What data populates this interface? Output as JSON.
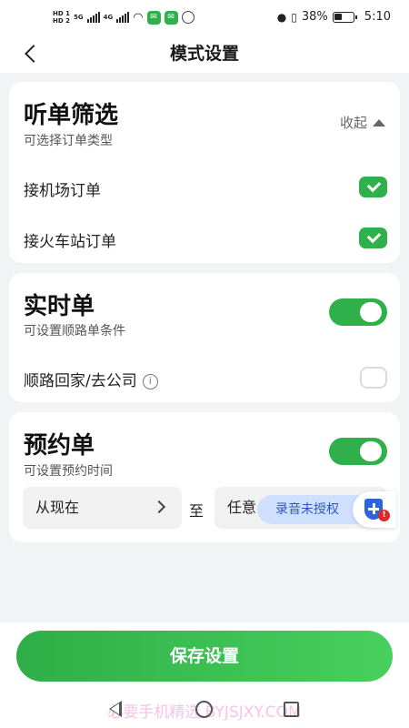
{
  "status_bar": {
    "hd1": "HD 1",
    "hd2": "HD 2",
    "net1": "5G",
    "net2": "4G",
    "battery": "38%",
    "time": "5:10"
  },
  "header": {
    "title": "模式设置"
  },
  "filter_card": {
    "title": "听单筛选",
    "subtitle": "可选择订单类型",
    "collapse_label": "收起",
    "options": [
      {
        "label": "接机场订单",
        "checked": true
      },
      {
        "label": "接火车站订单",
        "checked": true
      }
    ]
  },
  "realtime_card": {
    "title": "实时单",
    "subtitle": "可设置顺路单条件",
    "enabled": true,
    "option_label": "顺路回家/去公司",
    "option_checked": false
  },
  "reservation_card": {
    "title": "预约单",
    "subtitle": "可设置预约时间",
    "enabled": true,
    "from_label": "从现在",
    "to_label": "至",
    "until_label": "任意"
  },
  "recording_badge": {
    "label": "录音未授权"
  },
  "save_button": {
    "label": "保存设置"
  },
  "watermark": "必要手机精选 BYJSJXY.COM"
}
